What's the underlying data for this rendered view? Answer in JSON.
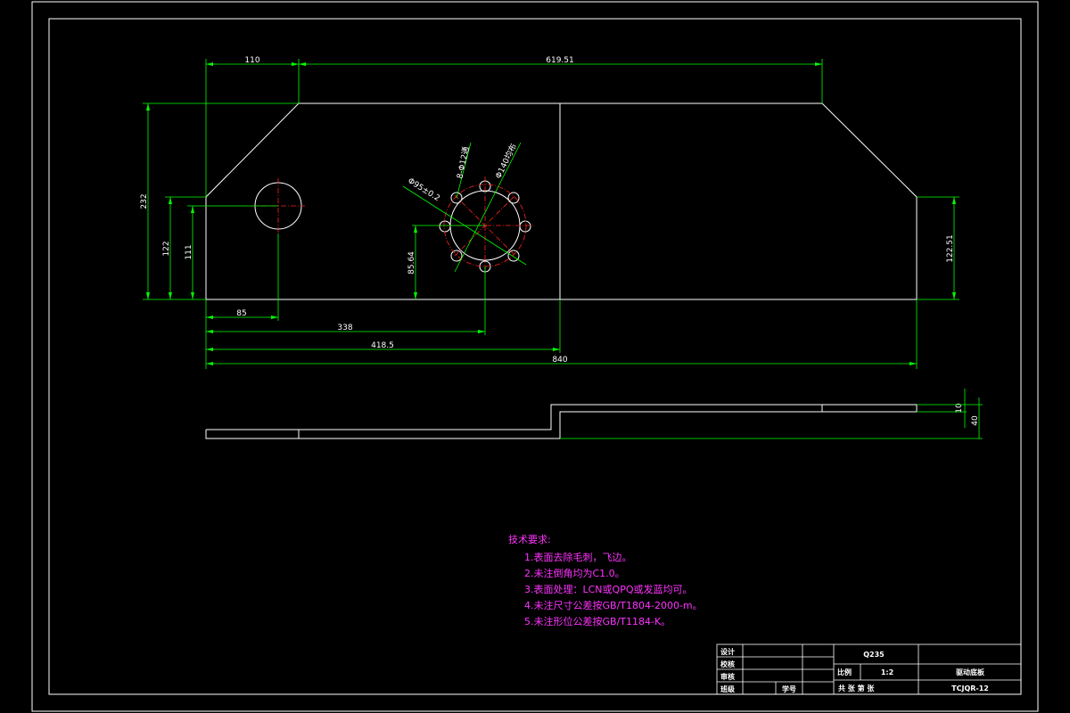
{
  "colors": {
    "background": "#000000",
    "outline": "#ffffff",
    "dimension": "#00ff00",
    "centerline": "#ff2020",
    "notes": "#ff33ff"
  },
  "dimensions": {
    "d110": "110",
    "d619_51": "619.51",
    "d232": "232",
    "d122": "122",
    "d111": "111",
    "d85": "85",
    "d338": "338",
    "d418_5": "418.5",
    "d840": "840",
    "d122_51": "122.51",
    "d85_64": "85.64",
    "d10": "10",
    "d40": "40",
    "phi95": "Φ95±0.2",
    "holes": "8-Φ12通",
    "pcd": "Φ140均布"
  },
  "notes": {
    "title": "技术要求:",
    "items": [
      "1.表面去除毛刺，飞边。",
      "2.未注倒角均为C1.0。",
      "3.表面处理：LCN或QPQ或发蓝均可。",
      "4.未注尺寸公差按GB/T1804-2000-m。",
      "5.未注形位公差按GB/T1184-K。"
    ]
  },
  "title_block": {
    "design": "设计",
    "check": "校核",
    "review": "审核",
    "class": "班级",
    "student_no": "学号",
    "material": "Q235",
    "scale_label": "比例",
    "scale": "1:2",
    "part_name": "驱动底板",
    "sheets": "共    张  第    张",
    "drawing_no": "TCJQR-12"
  }
}
